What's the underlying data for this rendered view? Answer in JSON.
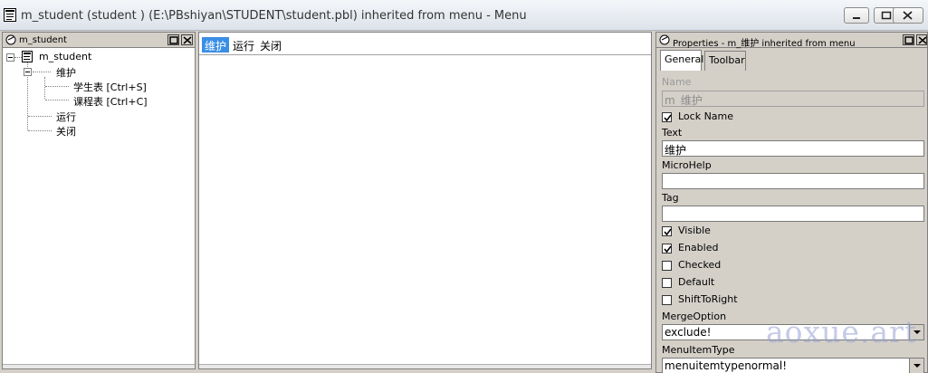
{
  "window": {
    "title": "m_student (student ) (E:\\PBshiyan\\STUDENT\\student.pbl) inherited from menu - Menu",
    "app_icon": "menu-painter-icon"
  },
  "tree_panel": {
    "title": "m_student",
    "root": "m_student",
    "items": [
      {
        "label": "维护",
        "children": [
          "学生表  [Ctrl+S]",
          "课程表  [Ctrl+C]"
        ]
      },
      {
        "label": "运行"
      },
      {
        "label": "关闭"
      }
    ]
  },
  "preview": {
    "items": [
      "维护",
      "运行",
      "关闭"
    ],
    "selected": "维护"
  },
  "properties": {
    "title": "Properties - m_维护  inherited from menu",
    "tabs": [
      "General",
      "Toolbar"
    ],
    "active_tab": "General",
    "name_label": "Name",
    "name_value": "m_维护",
    "lock_name_label": "Lock Name",
    "lock_name_checked": true,
    "text_label": "Text",
    "text_value": "维护",
    "microhelp_label": "MicroHelp",
    "microhelp_value": "",
    "tag_label": "Tag",
    "tag_value": "",
    "visible_label": "Visible",
    "enabled_label": "Enabled",
    "checked_label": "Checked",
    "default_label": "Default",
    "shifttoright_label": "ShiftToRight",
    "mergeoption_label": "MergeOption",
    "mergeoption_value": "exclude!",
    "menuitemtype_label": "MenuItemType",
    "menuitemtype_value": "menuitemtypenormal!"
  },
  "watermark": "aoxue.art",
  "colors": {
    "selection": "#3a8ee6",
    "chrome": "#d4d0c8"
  }
}
